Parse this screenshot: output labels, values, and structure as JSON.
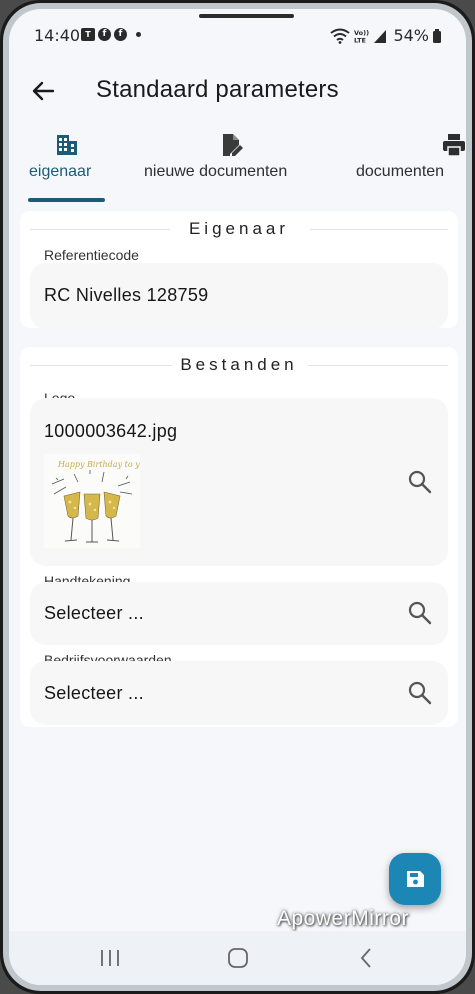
{
  "status_bar": {
    "time": "14:40",
    "battery": "54%",
    "notification_icons": [
      "teams-icon",
      "facebook-icon",
      "facebook-icon",
      "dot-icon"
    ],
    "system_icons": [
      "wifi-icon",
      "volte-icon",
      "signal-icon",
      "battery-icon"
    ]
  },
  "app_bar": {
    "title": "Standaard parameters",
    "back_icon": "arrow-left-icon"
  },
  "tabs": [
    {
      "label": "eigenaar",
      "icon": "building-icon",
      "active": true
    },
    {
      "label": "nieuwe documenten",
      "icon": "edit-document-icon",
      "active": false
    },
    {
      "label": "documenten",
      "icon": "printer-icon",
      "active": false
    }
  ],
  "sections": {
    "eigenaar": {
      "title": "Eigenaar",
      "fields": [
        {
          "label": "Referentiecode",
          "value": "RC Nivelles 128759"
        }
      ]
    },
    "bestanden": {
      "title": "Bestanden",
      "logo": {
        "label": "Logo",
        "value": "1000003642.jpg"
      },
      "handtekening": {
        "label": "Handtekening",
        "value": "Selecteer ..."
      },
      "voorwaarden": {
        "label": "Bedrijfsvoorwaarden",
        "value": "Selecteer ..."
      }
    }
  },
  "logo_image": {
    "text": "Happy Birthday to you"
  },
  "fab": {
    "icon": "save-icon"
  },
  "watermark": "ApowerMirror",
  "colors": {
    "accent": "#1b5b78",
    "fab": "#1c86b5",
    "background": "#f5f7fb"
  }
}
